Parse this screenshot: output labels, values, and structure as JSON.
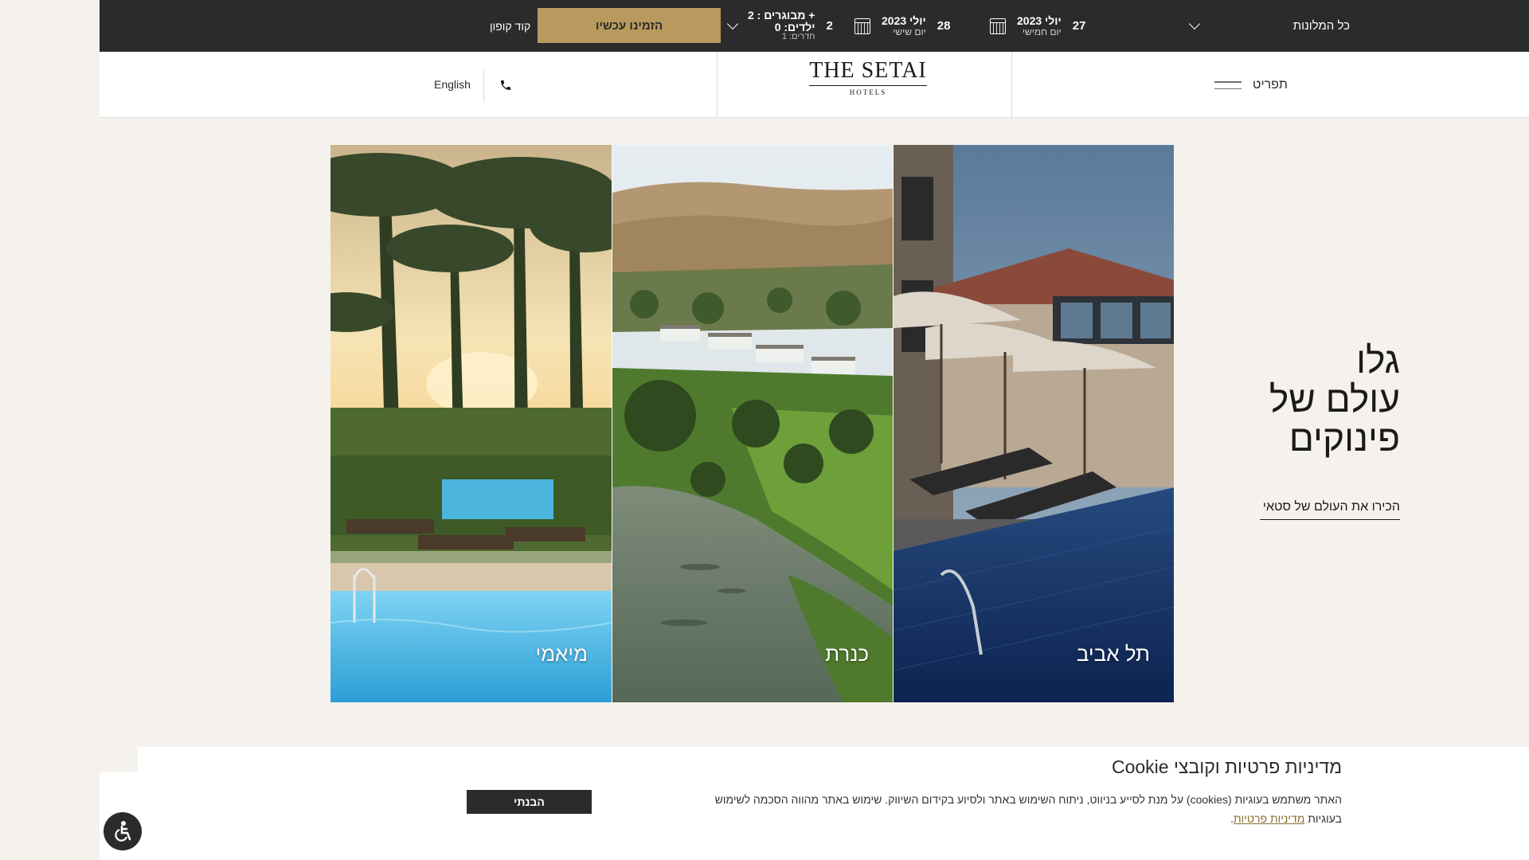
{
  "booking": {
    "hotel_select_label": "כל המלונות",
    "checkin": {
      "day": "27",
      "month": "יולי 2023",
      "weekday": "יום חמישי"
    },
    "checkout": {
      "day": "28",
      "month": "יולי 2023",
      "weekday": "יום שישי"
    },
    "guests": {
      "count": "2",
      "adults": "מבוגרים : 2 +",
      "children": "ילדים: 0",
      "rooms": "חדרים: 1"
    },
    "book_button": "הזמינו עכשיו",
    "coupon": "קוד קופון"
  },
  "header": {
    "menu_label": "תפריט",
    "logo_main": "THE SETAI",
    "logo_sub": "HOTELS",
    "language": "English"
  },
  "hero": {
    "title_lines": [
      "גלו",
      "עולם של",
      "פינוקים"
    ],
    "discover_link": "הכירו את העולם של סטאי",
    "destinations": [
      "תל אביב",
      "כנרת",
      "מיאמי"
    ]
  },
  "cookie": {
    "title": "מדיניות פרטיות וקובצי Cookie",
    "text": "האתר משתמש בעוגיות (cookies) על מנת לסייע בניווט, ניתוח השימוש באתר ולסיוע בקידום השיווק. שימוש באתר מהווה הסכמה לשימוש בעוגיות",
    "link": "מדיניות פרטיות",
    "accept": "הבנתי"
  },
  "colors": {
    "dark": "#2b2b2b",
    "gold": "#b89a5e",
    "background": "#f5f2ed"
  },
  "icons": [
    "chevron-down-icon",
    "calendar-icon",
    "phone-icon",
    "hamburger-menu-icon",
    "accessibility-icon"
  ]
}
